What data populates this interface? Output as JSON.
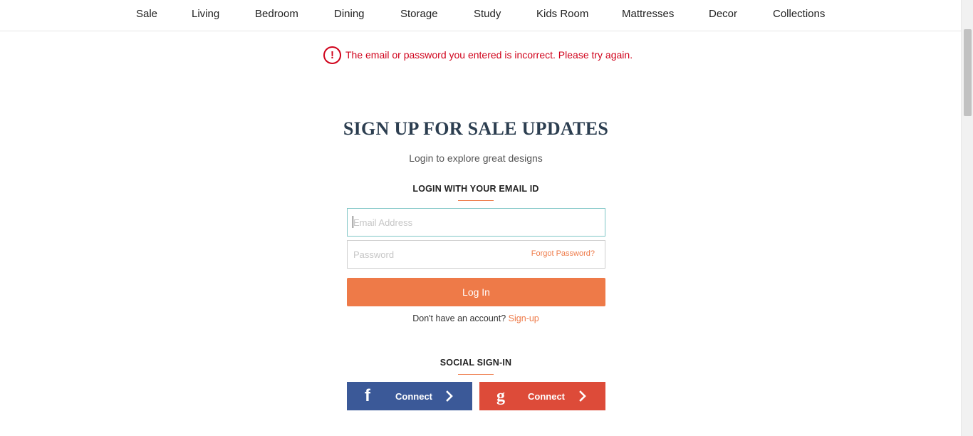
{
  "nav": {
    "items": [
      "Sale",
      "Living",
      "Bedroom",
      "Dining",
      "Storage",
      "Study",
      "Kids Room",
      "Mattresses",
      "Decor",
      "Collections"
    ]
  },
  "error": {
    "icon": "!",
    "message": "The email or password you entered is incorrect. Please try again."
  },
  "page": {
    "title": "SIGN UP FOR SALE UPDATES",
    "subtitle": "Login to explore great designs"
  },
  "login": {
    "heading": "LOGIN WITH YOUR EMAIL ID",
    "email_placeholder": "Email Address",
    "email_value": "",
    "password_placeholder": "Password",
    "password_value": "",
    "forgot_label": "Forgot Password?",
    "button_label": "Log In",
    "no_account_text": "Don't have an account?",
    "signup_label": "Sign-up"
  },
  "social": {
    "heading": "SOCIAL SIGN-IN",
    "facebook": {
      "icon": "f",
      "label": "Connect"
    },
    "google": {
      "icon": "g",
      "label": "Connect"
    }
  },
  "colors": {
    "accent": "#ee7a48",
    "error": "#d0021b",
    "facebook": "#3b5998",
    "google": "#dd4b39",
    "title": "#2c3e50"
  }
}
